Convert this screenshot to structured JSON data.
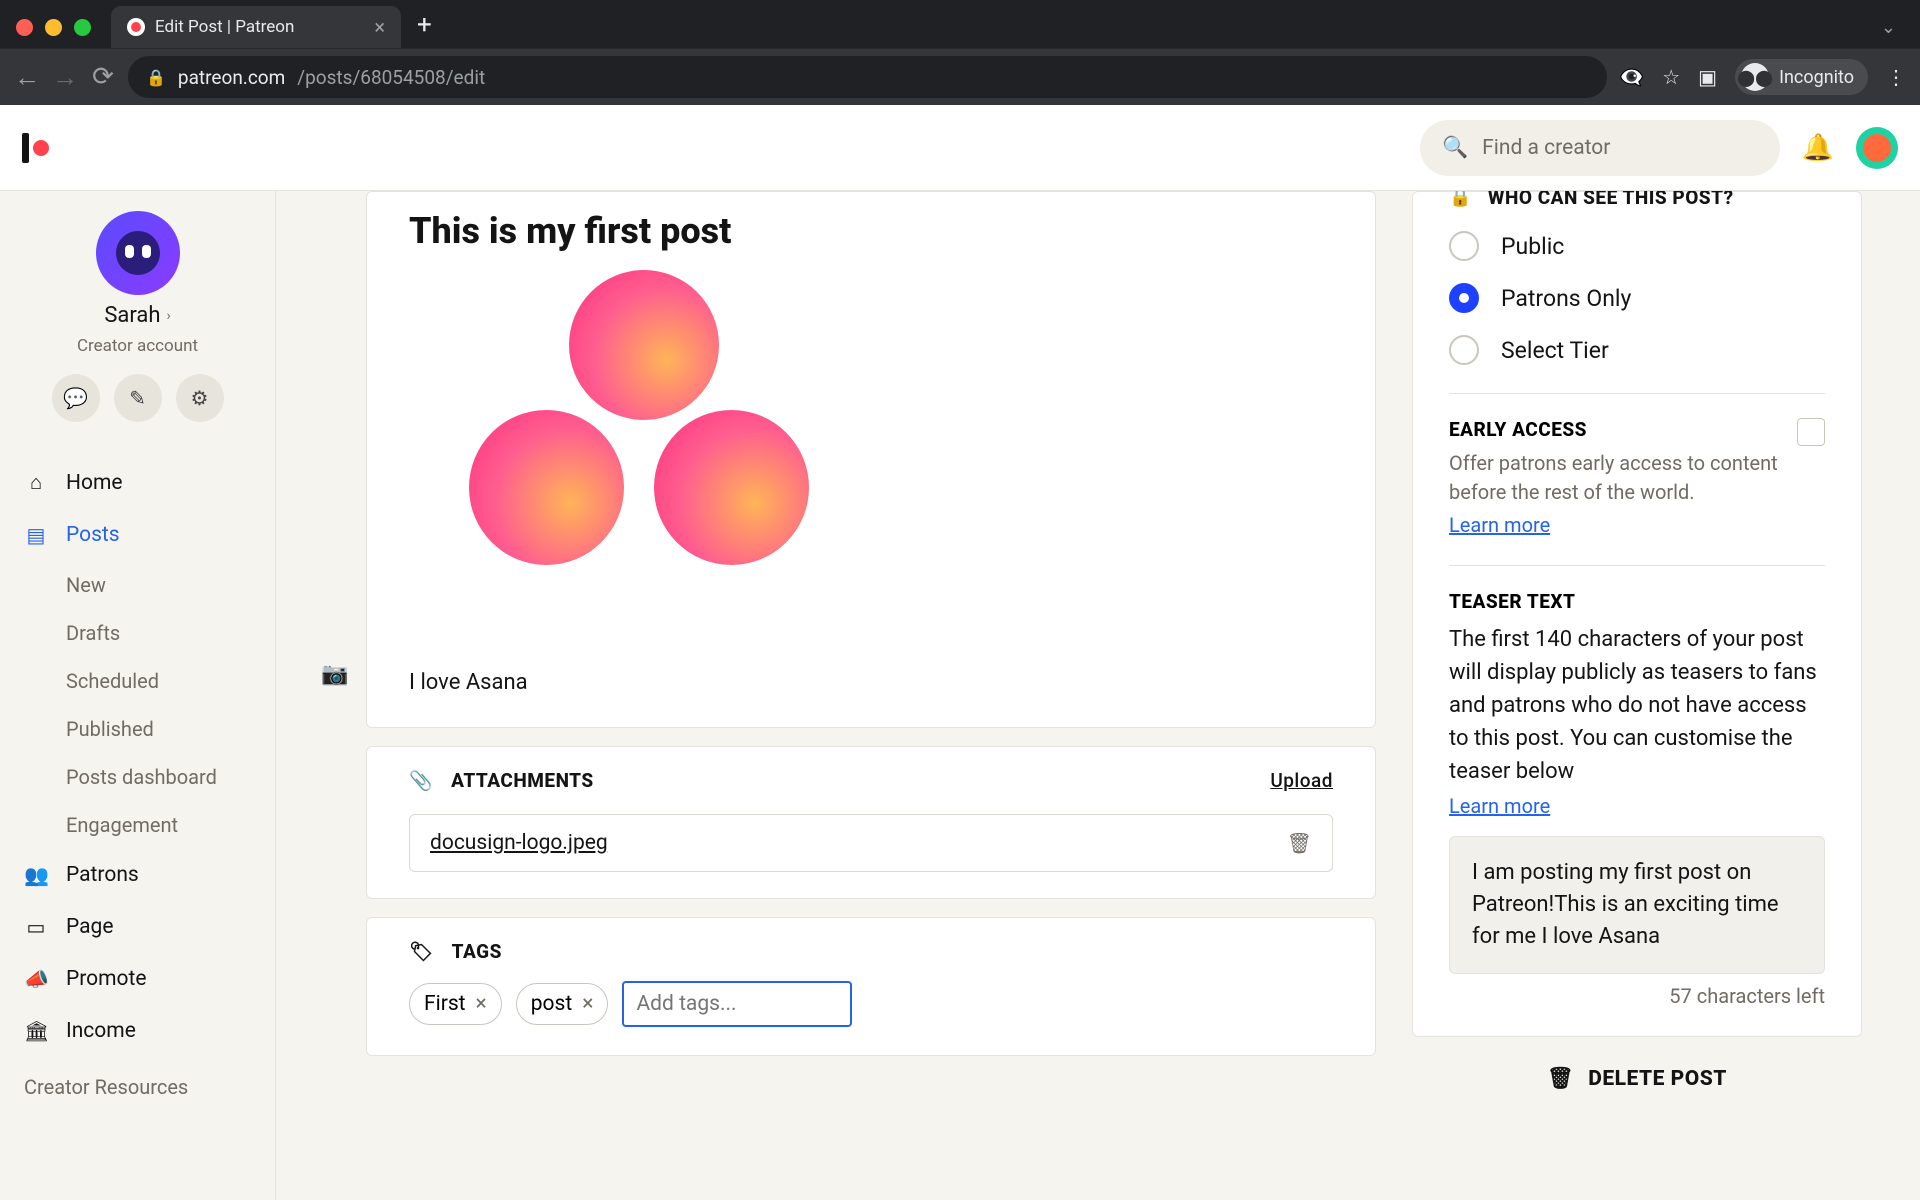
{
  "browser": {
    "tab_title": "Edit Post | Patreon",
    "url_host": "patreon.com",
    "url_path": "/posts/68054508/edit",
    "incognito_label": "Incognito"
  },
  "header": {
    "search_placeholder": "Find a creator"
  },
  "sidebar": {
    "profile": {
      "name": "Sarah",
      "role": "Creator account"
    },
    "items": [
      {
        "label": "Home"
      },
      {
        "label": "Posts"
      },
      {
        "label": "Patrons"
      },
      {
        "label": "Page"
      },
      {
        "label": "Promote"
      },
      {
        "label": "Income"
      }
    ],
    "posts_sub": [
      {
        "label": "New"
      },
      {
        "label": "Drafts"
      },
      {
        "label": "Scheduled"
      },
      {
        "label": "Published"
      },
      {
        "label": "Posts dashboard"
      },
      {
        "label": "Engagement"
      }
    ],
    "footer": "Creator Resources"
  },
  "post": {
    "title": "This is my first post",
    "body_text": "I love Asana"
  },
  "attachments": {
    "heading": "ATTACHMENTS",
    "upload_label": "Upload",
    "files": [
      {
        "name": "docusign-logo.jpeg"
      }
    ]
  },
  "tags": {
    "heading": "TAGS",
    "chips": [
      "First",
      "post"
    ],
    "input_placeholder": "Add tags..."
  },
  "visibility": {
    "heading": "WHO CAN SEE THIS POST?",
    "options": [
      {
        "label": "Public",
        "selected": false
      },
      {
        "label": "Patrons Only",
        "selected": true
      },
      {
        "label": "Select Tier",
        "selected": false
      }
    ]
  },
  "early_access": {
    "heading": "EARLY ACCESS",
    "description": "Offer patrons early access to content before the rest of the world.",
    "learn_more": "Learn more"
  },
  "teaser": {
    "heading": "TEASER TEXT",
    "description": "The first 140 characters of your post will display publicly as teasers to fans and patrons who do not have access to this post. You can customise the teaser below",
    "learn_more": "Learn more",
    "text": "I am posting my first post on Patreon!This is an exciting time for me  I love Asana",
    "chars_left": "57 characters left"
  },
  "delete_label": "DELETE POST"
}
